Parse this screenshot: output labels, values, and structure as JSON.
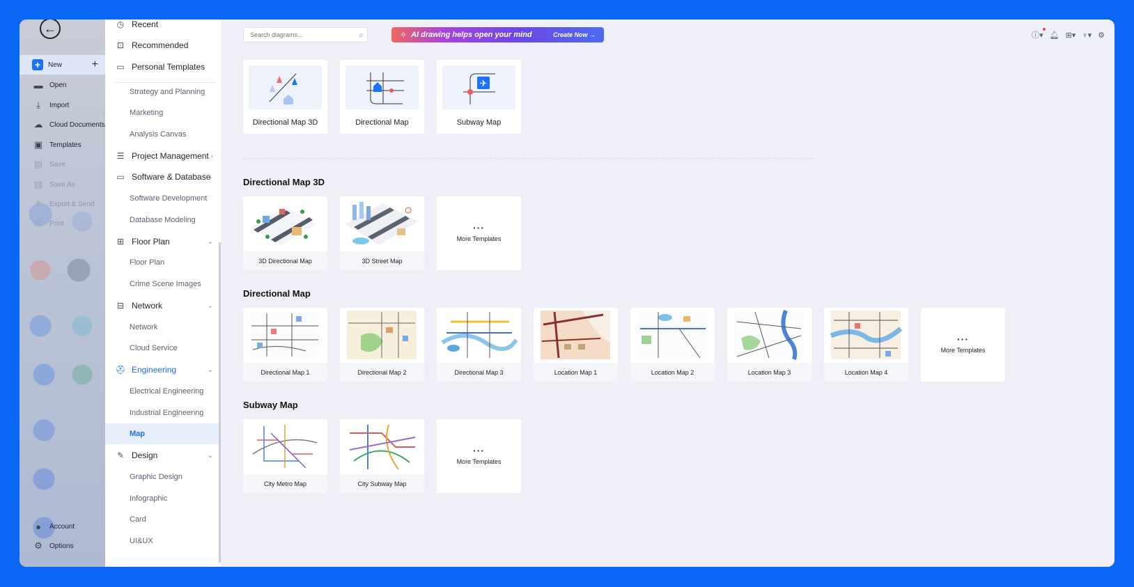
{
  "left_panel": {
    "items": [
      {
        "label": "New",
        "icon": "plus-icon",
        "state": "active"
      },
      {
        "label": "Open",
        "icon": "folder-icon",
        "state": "normal"
      },
      {
        "label": "Import",
        "icon": "import-icon",
        "state": "normal"
      },
      {
        "label": "Cloud Documents",
        "icon": "cloud-icon",
        "state": "normal"
      },
      {
        "label": "Templates",
        "icon": "templates-icon",
        "state": "normal"
      },
      {
        "label": "Save",
        "icon": "save-icon",
        "state": "disabled"
      },
      {
        "label": "Save As",
        "icon": "save-as-icon",
        "state": "disabled"
      },
      {
        "label": "Export & Send",
        "icon": "export-icon",
        "state": "disabled"
      },
      {
        "label": "Print",
        "icon": "print-icon",
        "state": "disabled"
      }
    ],
    "account_label": "Account",
    "options_label": "Options"
  },
  "categories": {
    "recent": "Recent",
    "recommended": "Recommended",
    "personal_templates": "Personal Templates",
    "strategy": "Strategy and Planning",
    "marketing": "Marketing",
    "analysis_canvas": "Analysis Canvas",
    "project_management": "Project Management",
    "software_database": "Software & Database",
    "software_development": "Software Development",
    "database_modeling": "Database Modeling",
    "floor_plan_cat": "Floor Plan",
    "floor_plan_sub": "Floor Plan",
    "crime_scene": "Crime Scene Images",
    "network_cat": "Network",
    "network_sub": "Network",
    "cloud_service": "Cloud Service",
    "engineering": "Engineering",
    "electrical": "Electrical Engineering",
    "industrial": "Industrial Engineering",
    "map": "Map",
    "design": "Design",
    "graphic_design": "Graphic Design",
    "infographic": "Infographic",
    "card": "Card",
    "uiux": "UI&UX"
  },
  "toolbar": {
    "search_placeholder": "Search diagrams...",
    "banner_text": "AI drawing helps open your mind",
    "banner_cta": "Create Now →"
  },
  "blank_templates": [
    "Directional Map 3D",
    "Directional Map",
    "Subway Map"
  ],
  "sections": [
    {
      "title": "Directional Map 3D",
      "templates": [
        "3D Directional Map",
        "3D Street Map"
      ],
      "more": "More Templates"
    },
    {
      "title": "Directional Map",
      "templates": [
        "Directional Map 1",
        "Directional Map 2",
        "Directional Map 3",
        "Location Map 1",
        "Location Map 2",
        "Location Map 3",
        "Location Map 4"
      ],
      "more": "More Templates"
    },
    {
      "title": "Subway Map",
      "templates": [
        "City Metro Map",
        "City Subway Map"
      ],
      "more": "More Templates"
    }
  ],
  "colors": {
    "accent": "#1a73ff",
    "frame": "#0a66f5"
  }
}
